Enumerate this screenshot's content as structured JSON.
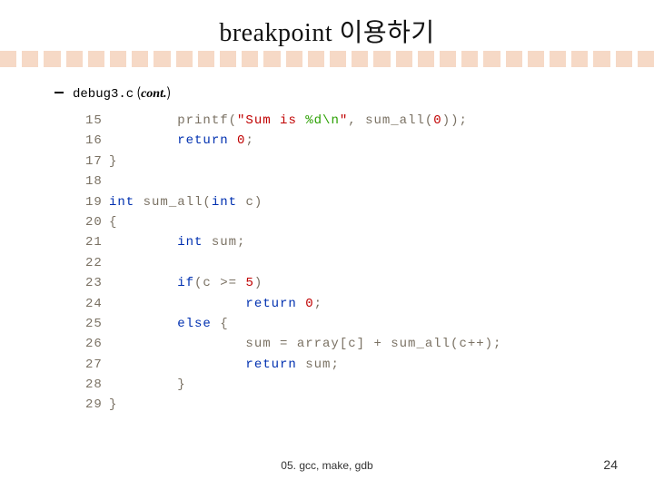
{
  "slide": {
    "title": "breakpoint 이용하기",
    "bullet": {
      "file": "debug3.c",
      "note_open": "(",
      "note": "cont.",
      "note_close": ")"
    }
  },
  "code": {
    "lines": [
      {
        "n": "15",
        "segs": [
          {
            "t": "        printf(",
            "c": ""
          },
          {
            "t": "\"Sum is ",
            "c": "s-red"
          },
          {
            "t": "%d\\n",
            "c": "s-green"
          },
          {
            "t": "\"",
            "c": "s-red"
          },
          {
            "t": ", sum_all(",
            "c": ""
          },
          {
            "t": "0",
            "c": "s-red"
          },
          {
            "t": "));",
            "c": ""
          }
        ]
      },
      {
        "n": "16",
        "segs": [
          {
            "t": "        ",
            "c": ""
          },
          {
            "t": "return",
            "c": "s-blue"
          },
          {
            "t": " ",
            "c": ""
          },
          {
            "t": "0",
            "c": "s-red"
          },
          {
            "t": ";",
            "c": ""
          }
        ]
      },
      {
        "n": "17",
        "segs": [
          {
            "t": "}",
            "c": ""
          }
        ]
      },
      {
        "n": "18",
        "segs": [
          {
            "t": "",
            "c": ""
          }
        ]
      },
      {
        "n": "19",
        "segs": [
          {
            "t": "int",
            "c": "s-blue"
          },
          {
            "t": " sum_all(",
            "c": ""
          },
          {
            "t": "int",
            "c": "s-blue"
          },
          {
            "t": " c)",
            "c": ""
          }
        ]
      },
      {
        "n": "20",
        "segs": [
          {
            "t": "{",
            "c": ""
          }
        ]
      },
      {
        "n": "21",
        "segs": [
          {
            "t": "        ",
            "c": ""
          },
          {
            "t": "int",
            "c": "s-blue"
          },
          {
            "t": " sum;",
            "c": ""
          }
        ]
      },
      {
        "n": "22",
        "segs": [
          {
            "t": "",
            "c": ""
          }
        ]
      },
      {
        "n": "23",
        "segs": [
          {
            "t": "        ",
            "c": ""
          },
          {
            "t": "if",
            "c": "s-blue"
          },
          {
            "t": "(c >= ",
            "c": ""
          },
          {
            "t": "5",
            "c": "s-red"
          },
          {
            "t": ")",
            "c": ""
          }
        ]
      },
      {
        "n": "24",
        "segs": [
          {
            "t": "                ",
            "c": ""
          },
          {
            "t": "return",
            "c": "s-blue"
          },
          {
            "t": " ",
            "c": ""
          },
          {
            "t": "0",
            "c": "s-red"
          },
          {
            "t": ";",
            "c": ""
          }
        ]
      },
      {
        "n": "25",
        "segs": [
          {
            "t": "        ",
            "c": ""
          },
          {
            "t": "else",
            "c": "s-blue"
          },
          {
            "t": " {",
            "c": ""
          }
        ]
      },
      {
        "n": "26",
        "segs": [
          {
            "t": "                sum = array[c] + sum_all(c++);",
            "c": ""
          }
        ]
      },
      {
        "n": "27",
        "segs": [
          {
            "t": "                ",
            "c": ""
          },
          {
            "t": "return",
            "c": "s-blue"
          },
          {
            "t": " sum;",
            "c": ""
          }
        ]
      },
      {
        "n": "28",
        "segs": [
          {
            "t": "        }",
            "c": ""
          }
        ]
      },
      {
        "n": "29",
        "segs": [
          {
            "t": "}",
            "c": ""
          }
        ]
      }
    ]
  },
  "footer": {
    "text": "05. gcc, make, gdb",
    "page": "24"
  }
}
